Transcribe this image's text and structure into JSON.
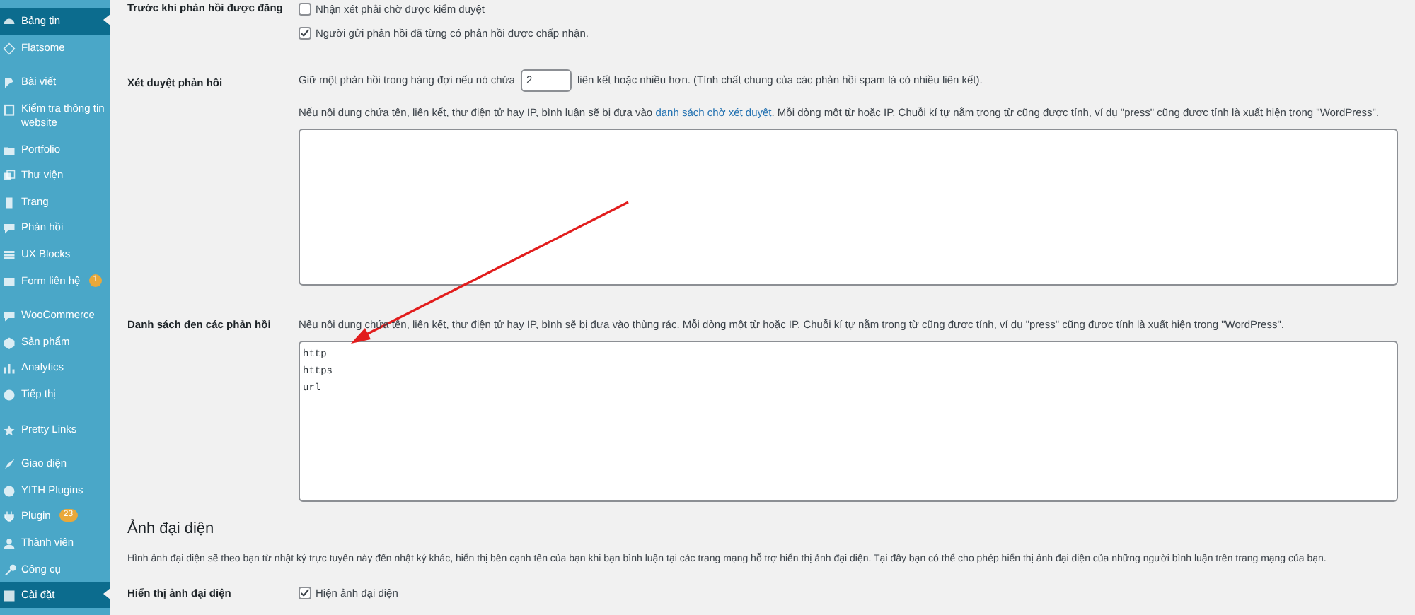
{
  "sidebar": {
    "groups": [
      {
        "items": [
          {
            "label": "Bảng tin",
            "selected": true
          },
          {
            "label": "Flatsome",
            "selected": false
          }
        ]
      },
      {
        "items": [
          {
            "label": "Bài viết",
            "selected": false
          },
          {
            "label": "Kiểm tra thông tin website",
            "selected": false
          },
          {
            "label": "Portfolio",
            "selected": false
          },
          {
            "label": "Thư viện",
            "selected": false
          },
          {
            "label": "Trang",
            "selected": false
          },
          {
            "label": "Phản hồi",
            "selected": false
          },
          {
            "label": "UX Blocks",
            "selected": false
          },
          {
            "label": "Form liên hệ",
            "selected": false,
            "badge": "1"
          }
        ]
      },
      {
        "items": [
          {
            "label": "WooCommerce",
            "selected": false
          },
          {
            "label": "Sản phẩm",
            "selected": false
          },
          {
            "label": "Analytics",
            "selected": false
          },
          {
            "label": "Tiếp thị",
            "selected": false
          }
        ]
      },
      {
        "items": [
          {
            "label": "Pretty Links",
            "selected": false
          }
        ]
      },
      {
        "items": [
          {
            "label": "Giao diện",
            "selected": false
          },
          {
            "label": "YITH Plugins",
            "selected": false
          },
          {
            "label": "Plugin",
            "selected": false,
            "badge": "23"
          },
          {
            "label": "Thành viên",
            "selected": false
          },
          {
            "label": "Công cụ",
            "selected": false
          },
          {
            "label": "Cài đặt",
            "selected": true
          }
        ]
      }
    ]
  },
  "settings": [
    {
      "kind": "checks",
      "label": "Trước khi phản hồi được đăng",
      "options": [
        {
          "label": "Nhận xét phải chờ được kiểm duyệt",
          "checked": false
        },
        {
          "label": "Người gửi phản hồi đã từng có phản hồi được chấp nhận.",
          "checked": true
        }
      ]
    },
    {
      "kind": "moderation",
      "label": "Xét duyệt phản hồi",
      "before": "Giữ một phản hồi trong hàng đợi nếu nó chứa",
      "links_value": "2",
      "after": "liên kết hoặc nhiều hơn. (Tính chất chung của các phản hồi spam là có nhiều liên kết).",
      "description_before": "Nếu nội dung chứa tên, liên kết, thư điện tử hay IP, bình luận sẽ bị đưa vào",
      "description_link": "danh sách chờ xét duyệt",
      "description_after": ". Mỗi dòng một từ hoặc IP. Chuỗi kí tự nằm trong từ cũng được tính, ví dụ \"press\" cũng được tính là xuất hiện trong \"WordPress\"."
    },
    {
      "kind": "blocklist",
      "label": "Danh sách đen các phản hồi",
      "description": "Nếu nội dung chứa tên, liên kết, thư điện tử hay IP, bình sẽ bị đưa vào thùng rác. Mỗi dòng một từ hoặc IP. Chuỗi kí tự nằm trong từ cũng được tính, ví dụ \"press\" cũng được tính là xuất hiện trong \"WordPress\".",
      "lines": [
        "http",
        "https",
        "url"
      ]
    }
  ],
  "avatar_section": {
    "heading": "Ảnh đại diện",
    "description": "Hình ảnh đại diện sẽ theo bạn từ nhật ký trực tuyến này đến nhật ký khác, hiển thị bên cạnh tên của bạn khi bạn bình luận tại các trang mạng hỗ trợ hiển thị ảnh đại diện. Tại đây bạn có thể cho phép hiển thị ảnh đại diện của những người bình luận trên trang mạng của bạn.",
    "label": "Hiển thị ảnh đại diện",
    "option": {
      "label": "Hiện ảnh đại diện",
      "checked": true
    }
  }
}
